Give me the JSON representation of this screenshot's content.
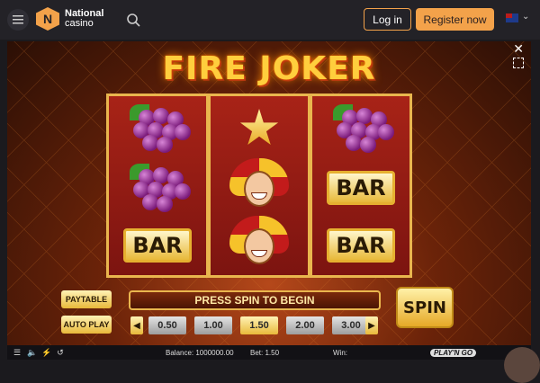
{
  "header": {
    "logo_letter": "N",
    "logo_line1": "National",
    "logo_line2": "casino",
    "login_label": "Log in",
    "register_label": "Register now"
  },
  "game": {
    "title": "FIRE JOKER",
    "reels": [
      [
        "grapes",
        "grapes",
        "bar"
      ],
      [
        "star",
        "joker",
        "joker"
      ],
      [
        "grapes",
        "bar",
        "bar"
      ]
    ],
    "bar_label": "BAR",
    "paytable_label": "PAYTABLE",
    "autoplay_label": "AUTO PLAY",
    "message": "PRESS SPIN TO BEGIN",
    "spin_label": "SPIN",
    "bets": [
      "0.50",
      "1.00",
      "1.50",
      "2.00",
      "3.00"
    ],
    "selected_bet": "1.50"
  },
  "status_bar": {
    "balance": "Balance: 1000000.00",
    "bet": "Bet: 1.50",
    "win": "Win:",
    "brand": "PLAY'N GO"
  },
  "colors": {
    "accent": "#f3a24a",
    "gold": "#e9b64e",
    "header_bg": "#232227"
  }
}
